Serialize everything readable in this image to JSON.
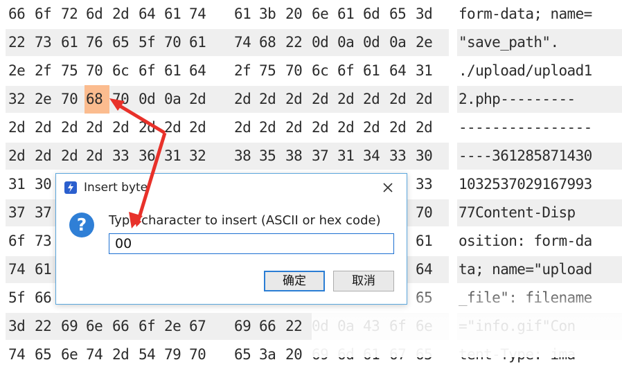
{
  "hex_rows": [
    {
      "bytes": [
        "66",
        "6f",
        "72",
        "6d",
        "2d",
        "64",
        "61",
        "74",
        "61",
        "3b",
        "20",
        "6e",
        "61",
        "6d",
        "65",
        "3d"
      ],
      "ascii": "form-data; name="
    },
    {
      "bytes": [
        "22",
        "73",
        "61",
        "76",
        "65",
        "5f",
        "70",
        "61",
        "74",
        "68",
        "22",
        "0d",
        "0a",
        "0d",
        "0a",
        "2e"
      ],
      "ascii": "\"save_path\"."
    },
    {
      "bytes": [
        "2e",
        "2f",
        "75",
        "70",
        "6c",
        "6f",
        "61",
        "64",
        "2f",
        "75",
        "70",
        "6c",
        "6f",
        "61",
        "64",
        "31"
      ],
      "ascii": "./upload/upload1"
    },
    {
      "bytes": [
        "32",
        "2e",
        "70",
        "68",
        "70",
        "0d",
        "0a",
        "2d",
        "2d",
        "2d",
        "2d",
        "2d",
        "2d",
        "2d",
        "2d",
        "2d"
      ],
      "ascii": "2.php---------",
      "selected_index": 3
    },
    {
      "bytes": [
        "2d",
        "2d",
        "2d",
        "2d",
        "2d",
        "2d",
        "2d",
        "2d",
        "2d",
        "2d",
        "2d",
        "2d",
        "2d",
        "2d",
        "2d",
        "2d"
      ],
      "ascii": "----------------"
    },
    {
      "bytes": [
        "2d",
        "2d",
        "2d",
        "2d",
        "33",
        "36",
        "31",
        "32",
        "38",
        "35",
        "38",
        "37",
        "31",
        "34",
        "33",
        "30"
      ],
      "ascii": "----361285871430"
    },
    {
      "bytes": [
        "31",
        "30",
        "",
        "",
        "",
        "",
        "",
        "",
        "",
        "",
        "",
        "",
        "",
        "",
        "",
        "33"
      ],
      "ascii": "1032537029167993"
    },
    {
      "bytes": [
        "37",
        "37",
        "",
        "",
        "",
        "",
        "",
        "",
        "",
        "",
        "",
        "",
        "",
        "",
        "",
        "70"
      ],
      "ascii": "77Content-Disp"
    },
    {
      "bytes": [
        "6f",
        "73",
        "",
        "",
        "",
        "",
        "",
        "",
        "",
        "",
        "",
        "",
        "",
        "",
        "",
        "61"
      ],
      "ascii": "osition: form-da"
    },
    {
      "bytes": [
        "74",
        "61",
        "",
        "",
        "",
        "",
        "",
        "",
        "",
        "",
        "",
        "",
        "",
        "",
        "",
        "64"
      ],
      "ascii": "ta; name=\"upload"
    },
    {
      "bytes": [
        "5f",
        "66",
        "",
        "",
        "",
        "",
        "",
        "",
        "",
        "",
        "",
        "",
        "",
        "",
        "",
        "65"
      ],
      "ascii": "_file\": filename"
    },
    {
      "bytes": [
        "3d",
        "22",
        "69",
        "6e",
        "66",
        "6f",
        "2e",
        "67",
        "69",
        "66",
        "22",
        "0d",
        "0a",
        "43",
        "6f",
        "6e"
      ],
      "ascii": "=\"info.gif\"Con"
    },
    {
      "bytes": [
        "74",
        "65",
        "6e",
        "74",
        "2d",
        "54",
        "79",
        "70",
        "65",
        "3a",
        "20",
        "69",
        "6d",
        "61",
        "67",
        "65"
      ],
      "ascii": "tent-Type: ima"
    }
  ],
  "dialog": {
    "title": "Insert byte",
    "prompt": "Type character to insert (ASCII or hex code)",
    "input_value": "00",
    "ok_label": "确定",
    "cancel_label": "取消",
    "question_glyph": "?"
  },
  "colors": {
    "selected_byte": "#fbbc8f",
    "arrow": "#e8312a",
    "dialog_border": "#5aa6dc",
    "input_border": "#1b6fd1"
  }
}
